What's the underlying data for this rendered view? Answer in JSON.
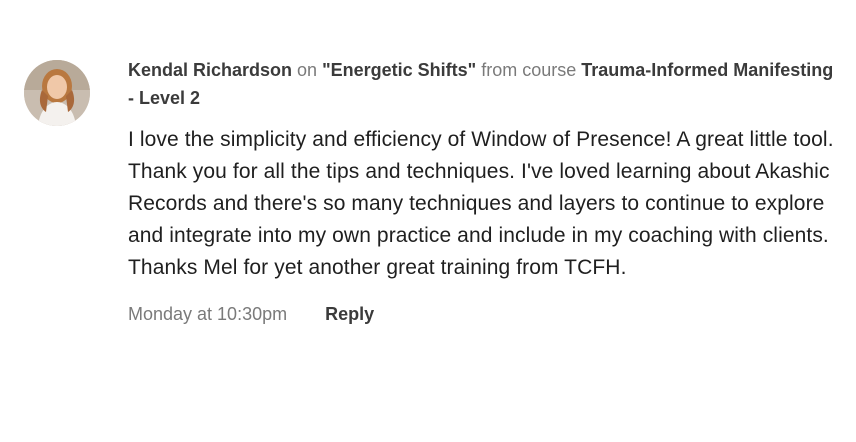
{
  "comment": {
    "author": "Kendal Richardson",
    "on_label": "on",
    "lesson_quoted": "\"Energetic Shifts\"",
    "from_label": "from course",
    "course": "Trauma-Informed Manifesting - Level 2",
    "paragraphs": [
      "I love the simplicity and efficiency of Window of Presence! A great little tool.",
      "Thank you for all the tips and techniques. I've loved learning about Akashic Records and there's so many techniques and layers to continue to explore and integrate into my own practice and include in my coaching with clients. Thanks Mel for yet another great training from TCFH."
    ],
    "timestamp": "Monday at 10:30pm",
    "reply_label": "Reply",
    "avatar_icon": "user-avatar-photo"
  }
}
